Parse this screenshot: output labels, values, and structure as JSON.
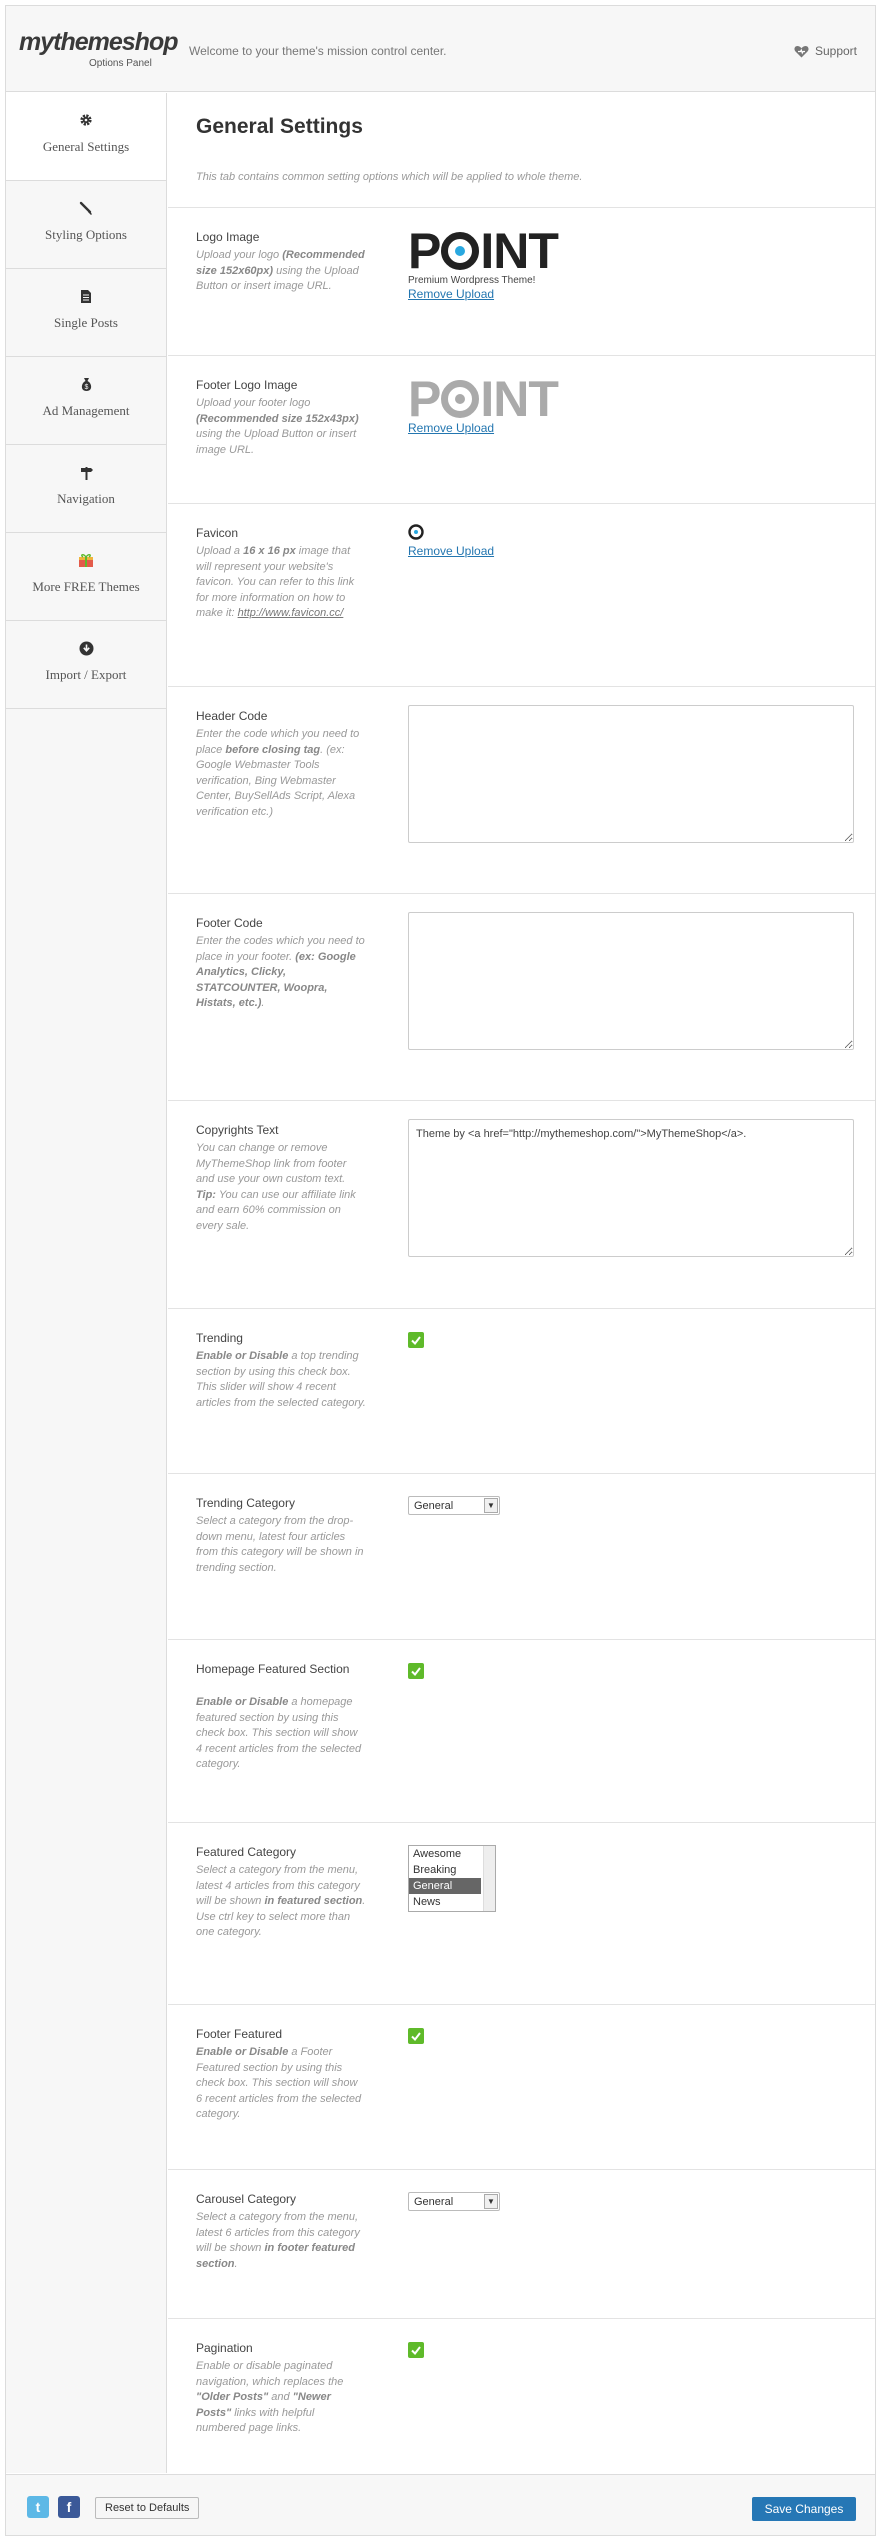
{
  "header": {
    "logo": "mythemeshop",
    "logo_sub": "Options Panel",
    "welcome": "Welcome to your theme's mission control center.",
    "support": "Support"
  },
  "sidebar": {
    "items": [
      {
        "label": "General Settings",
        "icon": "gear-icon"
      },
      {
        "label": "Styling Options",
        "icon": "brush-icon"
      },
      {
        "label": "Single Posts",
        "icon": "document-icon"
      },
      {
        "label": "Ad Management",
        "icon": "money-bag-icon"
      },
      {
        "label": "Navigation",
        "icon": "signpost-icon"
      },
      {
        "label": "More FREE Themes",
        "icon": "gift-icon"
      },
      {
        "label": "Import / Export",
        "icon": "download-icon"
      }
    ]
  },
  "main": {
    "title": "General Settings",
    "intro": "This tab contains common setting options which will be applied to whole theme.",
    "logo_image": {
      "label": "Logo Image",
      "desc_1": "Upload your logo",
      "desc_b": "(Recommended size 152x60px)",
      "desc_2": "using the Upload Button or insert image URL.",
      "logo_text_1": "P",
      "logo_text_2": "INT",
      "tagline": "Premium Wordpress Theme!",
      "remove": "Remove Upload"
    },
    "footer_logo": {
      "label": "Footer Logo Image",
      "desc_1": "Upload your footer logo",
      "desc_b": "(Recommended size 152x43px)",
      "desc_2": "using the Upload Button or insert image URL.",
      "logo_text_1": "P",
      "logo_text_2": "INT",
      "remove": "Remove Upload"
    },
    "favicon": {
      "label": "Favicon",
      "desc_1": "Upload a",
      "desc_b": "16 x 16 px",
      "desc_2": "image that will represent your website's favicon. You can refer to this link for more information on how to make it:",
      "link": "http://www.favicon.cc/",
      "remove": "Remove Upload"
    },
    "header_code": {
      "label": "Header Code",
      "desc_1": "Enter the code which you need to place",
      "desc_b": "before closing tag",
      "desc_2": ". (ex: Google Webmaster Tools verification, Bing Webmaster Center, BuySellAds Script, Alexa verification etc.)",
      "value": ""
    },
    "footer_code": {
      "label": "Footer Code",
      "desc_1": "Enter the codes which you need to place in your footer.",
      "desc_b": "(ex: Google Analytics, Clicky, STATCOUNTER, Woopra, Histats, etc.)",
      "desc_2": ".",
      "value": ""
    },
    "copyrights": {
      "label": "Copyrights Text",
      "desc_1": "You can change or remove MyThemeShop link from footer and use your own custom text.",
      "desc_b": "Tip:",
      "desc_2": "You can use our affiliate link and earn 60% commission on every sale.",
      "value": "Theme by <a href=\"http://mythemeshop.com/\">MyThemeShop</a>."
    },
    "trending": {
      "label": "Trending",
      "desc_b": "Enable or Disable",
      "desc_2": "a top trending section by using this check box. This slider will show 4 recent articles from the selected category.",
      "checked": true
    },
    "trending_category": {
      "label": "Trending Category",
      "desc": "Select a category from the drop-down menu, latest four articles from this category will be shown in trending section.",
      "selected": "General"
    },
    "homepage_featured": {
      "label": "Homepage Featured Section",
      "desc_b": "Enable or Disable",
      "desc_2": "a homepage featured section by using this check box. This section will show 4 recent articles from the selected category.",
      "checked": true
    },
    "featured_category": {
      "label": "Featured Category",
      "desc_1": "Select a category from the menu, latest 4 articles from this category will be shown",
      "desc_b": "in featured section",
      "desc_2": ". Use ctrl key to select more than one category.",
      "options": [
        "Awesome",
        "Breaking",
        "General",
        "News"
      ],
      "selected": "General"
    },
    "footer_featured": {
      "label": "Footer Featured",
      "desc_b": "Enable or Disable",
      "desc_2": "a Footer Featured section by using this check box. This section will show 6 recent articles from the selected category.",
      "checked": true
    },
    "carousel_category": {
      "label": "Carousel Category",
      "desc_1": "Select a category from the menu, latest 6 articles from this category will be shown",
      "desc_b": "in footer featured section",
      "desc_2": ".",
      "selected": "General"
    },
    "pagination": {
      "label": "Pagination",
      "desc_1": "Enable or disable paginated navigation, which replaces the",
      "desc_b1": "\"Older Posts\"",
      "desc_2": "and",
      "desc_b2": "\"Newer Posts\"",
      "desc_3": "links with helpful numbered page links.",
      "checked": true
    }
  },
  "footer": {
    "twitter": "t",
    "facebook": "f",
    "reset": "Reset to Defaults",
    "save": "Save Changes"
  },
  "colors": {
    "accent": "#2677b5",
    "check": "#5fba2a",
    "logo_dot": "#29a8e0"
  }
}
